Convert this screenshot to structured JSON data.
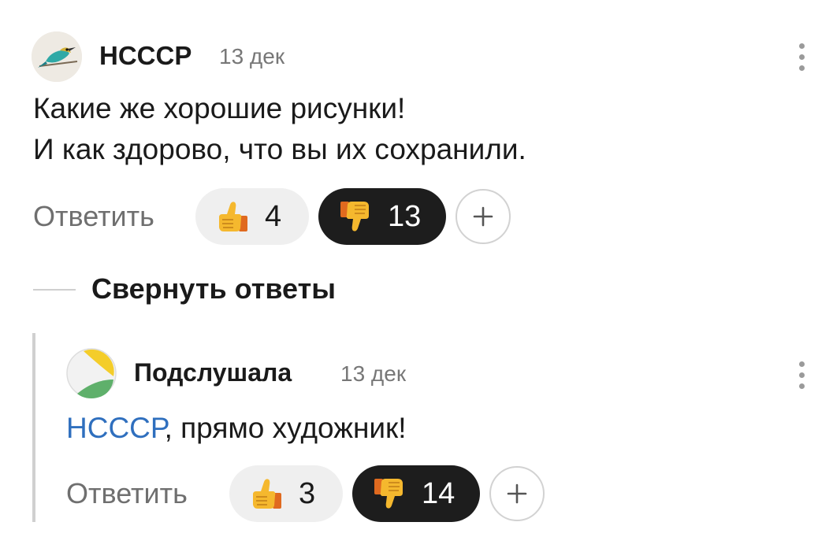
{
  "comment": {
    "author": "НСССР",
    "date": "13 дек",
    "lines": [
      "Какие же хорошие рисунки!",
      "И как здорово, что вы их сохранили."
    ],
    "reply_label": "Ответить",
    "likes": "4",
    "dislikes": "13",
    "avatar_icon": "bird-avatar-icon",
    "more_icon": "more-vertical-icon"
  },
  "collapse": {
    "label": "Свернуть ответы"
  },
  "reply": {
    "author": "Подслушала",
    "date": "13 дек",
    "mention": "НСССР",
    "text_rest": ", прямо художник!",
    "reply_label": "Ответить",
    "likes": "3",
    "dislikes": "14",
    "avatar_icon": "yellow-green-logo-icon",
    "more_icon": "more-vertical-icon"
  },
  "colors": {
    "mention": "#2f6fbe",
    "dislike_pill": "#1d1d1d",
    "like_pill": "#efefef",
    "thumb": "#f5b82e"
  }
}
